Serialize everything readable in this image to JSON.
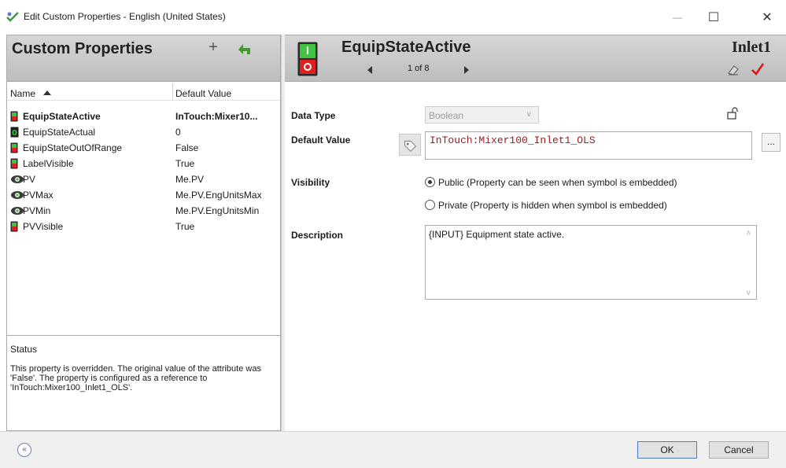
{
  "window": {
    "title": "Edit Custom Properties - English (United States)",
    "minimize_glyph": "—",
    "maximize_glyph": "☐",
    "close_glyph": "✕"
  },
  "left_panel": {
    "title": "Custom Properties",
    "add_glyph": "+",
    "columns": {
      "name": "Name",
      "default": "Default Value"
    },
    "properties": [
      {
        "name": "EquipStateActive",
        "default": "InTouch:Mixer10...",
        "icon": "switch-icon",
        "selected": true
      },
      {
        "name": "EquipStateActual",
        "default": "0",
        "icon": "integer-icon",
        "selected": false
      },
      {
        "name": "EquipStateOutOfRange",
        "default": "False",
        "icon": "switch-icon",
        "selected": false
      },
      {
        "name": "LabelVisible",
        "default": "True",
        "icon": "switch-icon",
        "selected": false
      },
      {
        "name": "PV",
        "default": "Me.PV",
        "icon": "eye-icon",
        "selected": false
      },
      {
        "name": "PVMax",
        "default": "Me.PV.EngUnitsMax",
        "icon": "eye-icon",
        "selected": false
      },
      {
        "name": "PVMin",
        "default": "Me.PV.EngUnitsMin",
        "icon": "eye-icon",
        "selected": false
      },
      {
        "name": "PVVisible",
        "default": "True",
        "icon": "switch-icon",
        "selected": false
      }
    ],
    "status": {
      "title": "Status",
      "text": "This property is overridden. The original value of the attribute was 'False'. The property is configured as a reference to 'InTouch:Mixer100_Inlet1_OLS'."
    }
  },
  "detail": {
    "property_name": "EquipStateActive",
    "position": "1 of 8",
    "instance": "Inlet1",
    "data_type_label": "Data Type",
    "data_type_value": "Boolean",
    "default_value_label": "Default Value",
    "default_value": "InTouch:Mixer100_Inlet1_OLS",
    "ellipsis": "...",
    "visibility_label": "Visibility",
    "public_option": "Public (Property can be seen when symbol is embedded)",
    "private_option": "Private (Property is hidden when symbol is embedded)",
    "visibility_selected": "public",
    "description_label": "Description",
    "description": "{INPUT} Equipment state active."
  },
  "footer": {
    "collapse_glyph": "«",
    "ok_label": "OK",
    "cancel_label": "Cancel"
  },
  "colors": {
    "header_gradient_top": "#d6d6d6",
    "header_gradient_bottom": "#bdbdbd",
    "default_value_text": "#9b1b1b",
    "accent_check": "#d11b1b",
    "ok_border": "#4a7cc9"
  }
}
